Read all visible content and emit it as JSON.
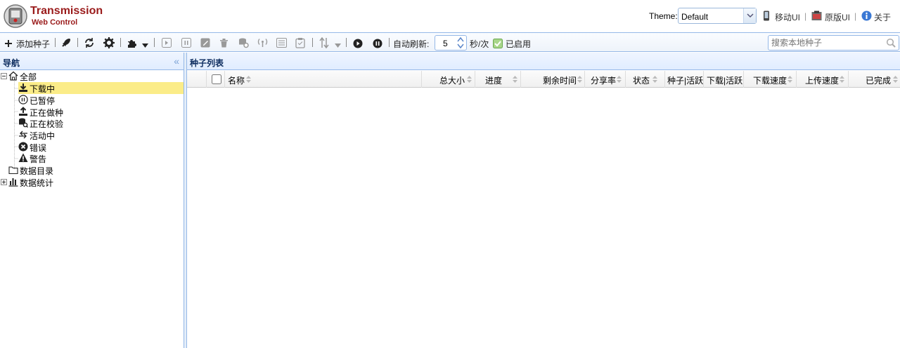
{
  "header": {
    "logo_title": "Transmission",
    "logo_subtitle": "Web Control",
    "theme_label": "Theme:",
    "theme_value": "Default",
    "links": [
      {
        "label": "移动UI",
        "icon": "mobile-icon"
      },
      {
        "label": "原版UI",
        "icon": "original-ui-icon"
      },
      {
        "label": "关于",
        "icon": "info-icon"
      }
    ],
    "separator": "|"
  },
  "toolbar": {
    "add_label": "添加种子",
    "auto_refresh_label": "自动刷新:",
    "refresh_value": "5",
    "refresh_unit": "秒/次",
    "enabled_label": "已启用",
    "search_placeholder": "搜索本地种子"
  },
  "nav": {
    "title": "导航",
    "items": [
      {
        "label": "全部",
        "icon": "home-icon"
      },
      {
        "label": "下载中",
        "icon": "download-icon"
      },
      {
        "label": "已暂停",
        "icon": "pause-icon"
      },
      {
        "label": "正在做种",
        "icon": "upload-icon"
      },
      {
        "label": "正在校验",
        "icon": "check-icon"
      },
      {
        "label": "活动中",
        "icon": "active-icon"
      },
      {
        "label": "错误",
        "icon": "error-icon"
      },
      {
        "label": "警告",
        "icon": "warning-icon"
      },
      {
        "label": "数据目录",
        "icon": "folder-icon"
      },
      {
        "label": "数据统计",
        "icon": "stats-icon"
      }
    ]
  },
  "main": {
    "title": "种子列表",
    "columns": [
      "名称",
      "总大小",
      "进度",
      "剩余时间",
      "分享率",
      "状态",
      "种子|活跃",
      "下载|活跃",
      "下载速度",
      "上传速度",
      "已完成"
    ]
  },
  "colors": {
    "border": "#95b8e7",
    "selected": "#fbec88",
    "brand": "#9a1b1b"
  }
}
